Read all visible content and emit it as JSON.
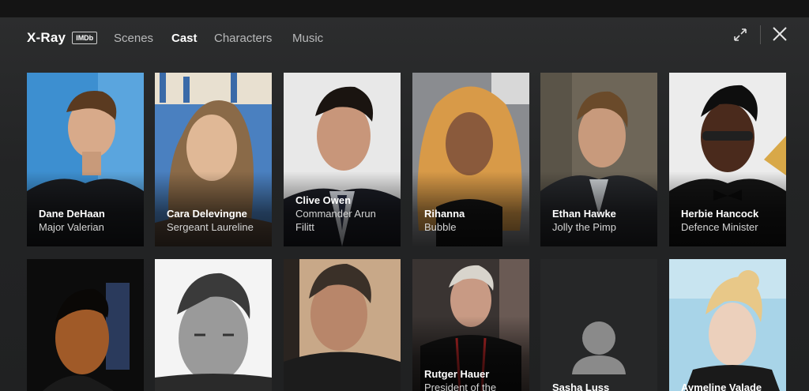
{
  "header": {
    "title": "X-Ray",
    "badge": "IMDb",
    "tabs": [
      {
        "label": "Scenes",
        "active": false
      },
      {
        "label": "Cast",
        "active": true
      },
      {
        "label": "Characters",
        "active": false
      },
      {
        "label": "Music",
        "active": false
      }
    ],
    "expand_icon": "expand-icon",
    "close_icon": "close-icon"
  },
  "cast": [
    {
      "actor": "Dane DeHaan",
      "role": "Major Valerian"
    },
    {
      "actor": "Cara Delevingne",
      "role": "Sergeant Laureline"
    },
    {
      "actor": "Clive Owen",
      "role": "Commander Arun Filitt"
    },
    {
      "actor": "Rihanna",
      "role": "Bubble"
    },
    {
      "actor": "Ethan Hawke",
      "role": "Jolly the Pimp"
    },
    {
      "actor": "Herbie Hancock",
      "role": "Defence Minister"
    },
    {
      "actor": "",
      "role": ""
    },
    {
      "actor": "",
      "role": ""
    },
    {
      "actor": "",
      "role": ""
    },
    {
      "actor": "Rutger Hauer",
      "role": "President of the"
    },
    {
      "actor": "Sasha Luss",
      "role": ""
    },
    {
      "actor": "Aymeline Valade",
      "role": ""
    }
  ],
  "colors": {
    "background": "#202122",
    "active_tab": "#ffffff",
    "inactive_tab": "#b8b9ba"
  }
}
